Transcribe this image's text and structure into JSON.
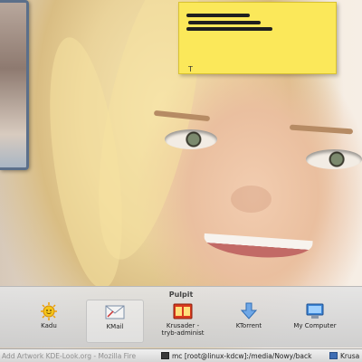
{
  "desktop": {
    "wallpaper": "portrait-photo",
    "sticky_note": {
      "caret": "T",
      "color": "#fbe85a"
    }
  },
  "panel": {
    "title": "Pulpit",
    "items": [
      {
        "label": "Kadu",
        "icon": "kadu-sun-icon"
      },
      {
        "label": "KMail",
        "icon": "kmail-icon"
      },
      {
        "label": "Krusader -\ntryb-administ",
        "icon": "krusader-icon"
      },
      {
        "label": "KTorrent",
        "icon": "ktorrent-icon"
      },
      {
        "label": "My Computer",
        "icon": "computer-icon"
      }
    ]
  },
  "taskbar": {
    "tasks": [
      {
        "label": "Add Artwork KDE-Look.org - Mozilla Fire",
        "state": "inactive"
      },
      {
        "label": "mc [root@linux-kdcw]:/media/Nowy/back",
        "state": "active"
      },
      {
        "label": "Krusa",
        "state": "active"
      }
    ]
  }
}
